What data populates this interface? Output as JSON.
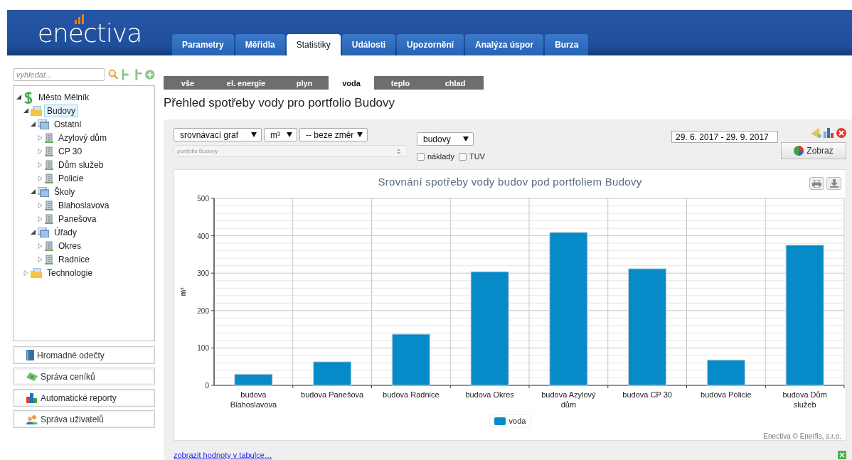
{
  "header": {
    "logo": "enectiva",
    "tabs": [
      {
        "label": "Parametry",
        "selected": false
      },
      {
        "label": "Měřidla",
        "selected": false
      },
      {
        "label": "Statistiky",
        "selected": true
      },
      {
        "label": "Události",
        "selected": false
      },
      {
        "label": "Upozornění",
        "selected": false
      },
      {
        "label": "Analýza úspor",
        "selected": false
      },
      {
        "label": "Burza",
        "selected": false
      }
    ]
  },
  "sidebar": {
    "search": {
      "placeholder": "vyhledat..."
    },
    "tree": [
      {
        "label": "Město Mělník",
        "kind": "portfolio",
        "expanded": true,
        "selected": false,
        "children": [
          {
            "label": "Budovy",
            "kind": "folder",
            "expanded": true,
            "selected": true,
            "children": [
              {
                "label": "Ostatní",
                "kind": "group",
                "expanded": true,
                "selected": false,
                "children": [
                  {
                    "label": "Azylový dům",
                    "kind": "building",
                    "expanded": false,
                    "selected": false
                  },
                  {
                    "label": "CP 30",
                    "kind": "building",
                    "expanded": false,
                    "selected": false
                  },
                  {
                    "label": "Dům služeb",
                    "kind": "building",
                    "expanded": false,
                    "selected": false
                  },
                  {
                    "label": "Policie",
                    "kind": "building",
                    "expanded": false,
                    "selected": false
                  }
                ]
              },
              {
                "label": "Školy",
                "kind": "group",
                "expanded": true,
                "selected": false,
                "children": [
                  {
                    "label": "Blahoslavova",
                    "kind": "building",
                    "expanded": false,
                    "selected": false
                  },
                  {
                    "label": "Panešova",
                    "kind": "building",
                    "expanded": false,
                    "selected": false
                  }
                ]
              },
              {
                "label": "Úřady",
                "kind": "group",
                "expanded": true,
                "selected": false,
                "children": [
                  {
                    "label": "Okres",
                    "kind": "building",
                    "expanded": false,
                    "selected": false
                  },
                  {
                    "label": "Radnice",
                    "kind": "building",
                    "expanded": false,
                    "selected": false
                  }
                ]
              }
            ]
          },
          {
            "label": "Technologie",
            "kind": "folder",
            "expanded": false,
            "selected": false
          }
        ]
      }
    ],
    "buttons": [
      {
        "label": "Hromadné odečty",
        "kind": "book"
      },
      {
        "label": "Správa ceníků",
        "kind": "money"
      },
      {
        "label": "Automatické reporty",
        "kind": "chart"
      },
      {
        "label": "Správa uživatelů",
        "kind": "users"
      }
    ]
  },
  "energy_tabs": [
    {
      "label": "vše",
      "selected": false
    },
    {
      "label": "el. energie",
      "selected": false
    },
    {
      "label": "plyn",
      "selected": false
    },
    {
      "label": "voda",
      "selected": true
    },
    {
      "label": "teplo",
      "selected": false
    },
    {
      "label": "chlad",
      "selected": false
    }
  ],
  "page_title": "Přehled spotřeby vody pro portfolio Budovy",
  "filters": {
    "graph_type": "srovnávací graf",
    "unit": "m³",
    "direction": "-- beze změr",
    "portfolio": "portfolio Budovy",
    "entity": "budovy",
    "checkboxes": [
      {
        "label": "náklady",
        "checked": false
      },
      {
        "label": "TUV",
        "checked": false
      }
    ],
    "date_range": "29. 6. 2017 - 29. 9. 2017",
    "show_button": "Zobraz"
  },
  "chart": {
    "credits": "Enectiva © Enerfis, s.r.o.",
    "chart_data": {
      "type": "bar",
      "title": "Srovnání spotřeby vody budov pod portfoliem Budovy",
      "ylabel": "m³",
      "categories": [
        "budova Blahoslavova",
        "budova Panešova",
        "budova Radnice",
        "budova Okres",
        "budova Azylový dům",
        "budova CP 30",
        "budova Policie",
        "budova Dům služeb"
      ],
      "series": [
        {
          "name": "voda",
          "color": "#068ac8",
          "values": [
            30,
            63,
            137,
            304,
            409,
            312,
            68,
            375
          ]
        }
      ],
      "grid": true,
      "ylim": [
        0,
        500
      ],
      "yticks": [
        0,
        100,
        200,
        300,
        400,
        500
      ]
    }
  },
  "footer_link": "zobrazit hodnoty v tabulce…"
}
